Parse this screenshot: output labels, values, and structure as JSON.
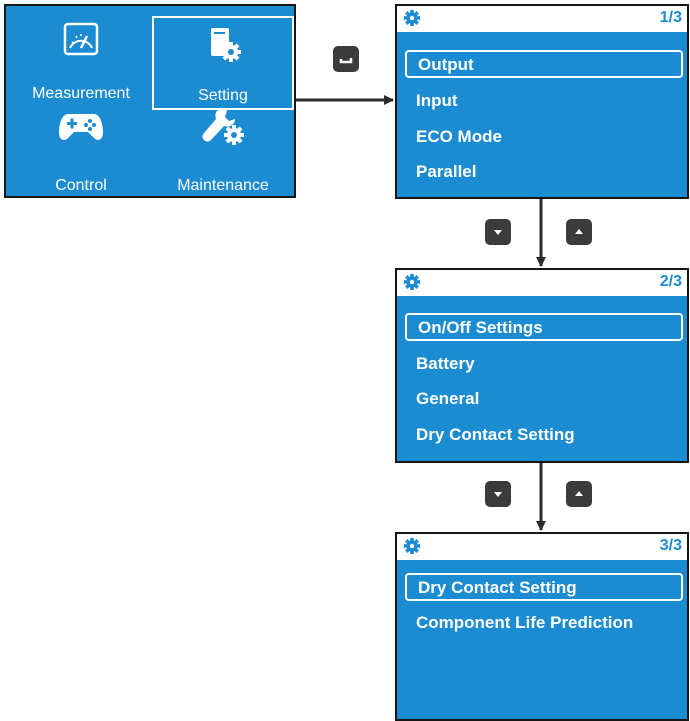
{
  "colors": {
    "screen_bg": "#1b8bd2",
    "header_bg": "#ffffff",
    "text": "#ffffff",
    "key_bg": "#3b3b3b",
    "arrow": "#2b2b2b"
  },
  "main_menu": {
    "items": [
      {
        "label": "Measurement",
        "icon": "gauge-icon",
        "selected": false
      },
      {
        "label": "Setting",
        "icon": "settings-icon",
        "selected": true
      },
      {
        "label": "Control",
        "icon": "gamepad-icon",
        "selected": false
      },
      {
        "label": "Maintenance",
        "icon": "wrench-gear-icon",
        "selected": false
      }
    ]
  },
  "keys": {
    "enter": "enter-key-icon",
    "down": "down-key-icon",
    "up": "up-key-icon"
  },
  "screens": [
    {
      "page": "1/3",
      "items": [
        "Output",
        "Input",
        "ECO Mode",
        "Parallel"
      ],
      "selected": 0
    },
    {
      "page": "2/3",
      "items": [
        "On/Off Settings",
        "Battery",
        "General",
        "Dry Contact Setting"
      ],
      "selected": 0
    },
    {
      "page": "3/3",
      "items": [
        "Dry Contact Setting",
        "Component Life Prediction"
      ],
      "selected": 0
    }
  ]
}
